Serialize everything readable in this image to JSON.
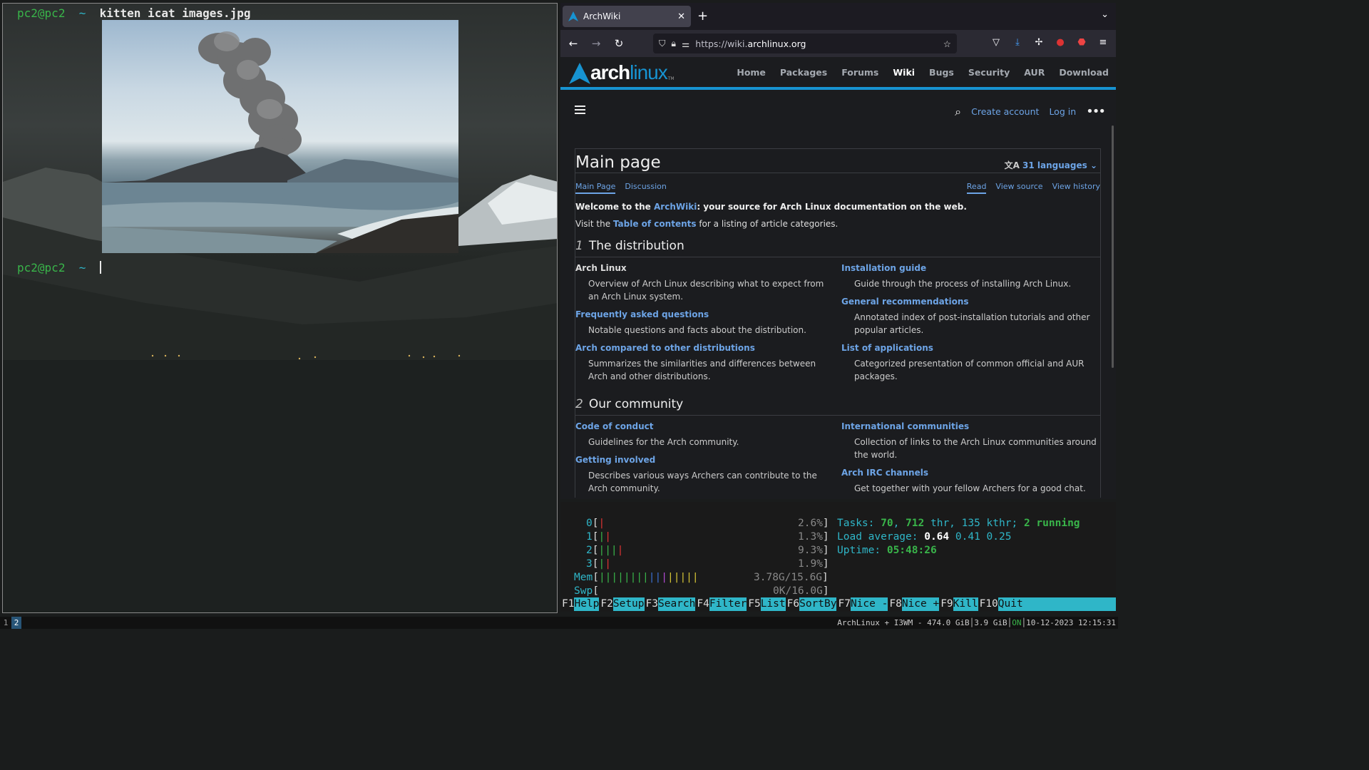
{
  "terminal": {
    "user": "pc2",
    "host": "pc2",
    "dir": "~",
    "command": "kitten icat images.jpg"
  },
  "browser": {
    "tab_title": "ArchWiki",
    "url_scheme": "https://wiki.",
    "url_host": "archlinux.org",
    "new_tab": "+",
    "close": "✕"
  },
  "site": {
    "logo_arch": "arch",
    "logo_linux": "linux",
    "logo_tm": "TM",
    "nav": [
      "Home",
      "Packages",
      "Forums",
      "Wiki",
      "Bugs",
      "Security",
      "AUR",
      "Download"
    ],
    "nav_active": "Wiki",
    "create_account": "Create account",
    "log_in": "Log in",
    "page_title": "Main page",
    "languages": "31 languages",
    "tab_main": "Main Page",
    "tab_discussion": "Discussion",
    "tab_read": "Read",
    "tab_view_source": "View source",
    "tab_view_history": "View history",
    "welcome_prefix": "Welcome to the ",
    "welcome_link": "ArchWiki",
    "welcome_suffix": ": your source for Arch Linux documentation on the web.",
    "visit_prefix": "Visit the ",
    "visit_link": "Table of contents",
    "visit_suffix": " for a listing of article categories.",
    "sec1_num": "1",
    "sec1_title": "The distribution",
    "sec2_num": "2",
    "sec2_title": "Our community",
    "dist_items": [
      {
        "title": "Arch Linux",
        "desc": "Overview of Arch Linux describing what to expect from an Arch Linux system."
      },
      {
        "title": "Installation guide",
        "desc": "Guide through the process of installing Arch Linux."
      },
      {
        "title": "Frequently asked questions",
        "desc": "Notable questions and facts about the distribution."
      },
      {
        "title": "General recommendations",
        "desc": "Annotated index of post-installation tutorials and other popular articles."
      },
      {
        "title": "Arch compared to other distributions",
        "desc": "Summarizes the similarities and differences between Arch and other distributions."
      },
      {
        "title": "List of applications",
        "desc": "Categorized presentation of common official and AUR packages."
      }
    ],
    "community_items": [
      {
        "title": "Code of conduct",
        "desc": "Guidelines for the Arch community."
      },
      {
        "title": "International communities",
        "desc": "Collection of links to the Arch Linux communities around the world."
      },
      {
        "title": "Getting involved",
        "desc": "Describes various ways Archers can contribute to the Arch community."
      },
      {
        "title": "Arch IRC channels",
        "desc": "Get together with your fellow Archers for a good chat."
      }
    ]
  },
  "htop": {
    "cpu0_label": "0",
    "cpu0_pct": "2.6%",
    "cpu1_label": "1",
    "cpu1_pct": "1.3%",
    "cpu2_label": "2",
    "cpu2_pct": "9.3%",
    "cpu3_label": "3",
    "cpu3_pct": "1.9%",
    "mem_label": "Mem",
    "mem_val": "3.78G/15.6G",
    "swp_label": "Swp",
    "swp_val": "0K/16.0G",
    "tasks_label": "Tasks: ",
    "tasks": "70",
    "thr": "712",
    "thr_label": " thr",
    "kthr": "135 kthr",
    "running": "2",
    "running_label": " running",
    "load_label": "Load average: ",
    "load1": "0.64",
    "load5": "0.41",
    "load15": "0.25",
    "uptime_label": "Uptime: ",
    "uptime": "05:48:26",
    "fkeys": [
      {
        "key": "F1",
        "label": "Help  "
      },
      {
        "key": "F2",
        "label": "Setup "
      },
      {
        "key": "F3",
        "label": "Search"
      },
      {
        "key": "F4",
        "label": "Filter"
      },
      {
        "key": "F5",
        "label": "List  "
      },
      {
        "key": "F6",
        "label": "SortBy"
      },
      {
        "key": "F7",
        "label": "Nice -"
      },
      {
        "key": "F8",
        "label": "Nice +"
      },
      {
        "key": "F9",
        "label": "Kill  "
      },
      {
        "key": "F10",
        "label": "Quit      "
      }
    ]
  },
  "statusbar": {
    "ws1": "1",
    "ws2": "2",
    "info": "ArchLinux + I3WM - 474.0 GiB│3.9 GiB│",
    "on": "ON",
    "datetime": "│10-12-2023 12:15:31"
  },
  "colors": {
    "arch_blue": "#1793d1",
    "link": "#6da4e6",
    "htop_cyan": "#2fb6c8",
    "prompt_green": "#39b54a"
  }
}
